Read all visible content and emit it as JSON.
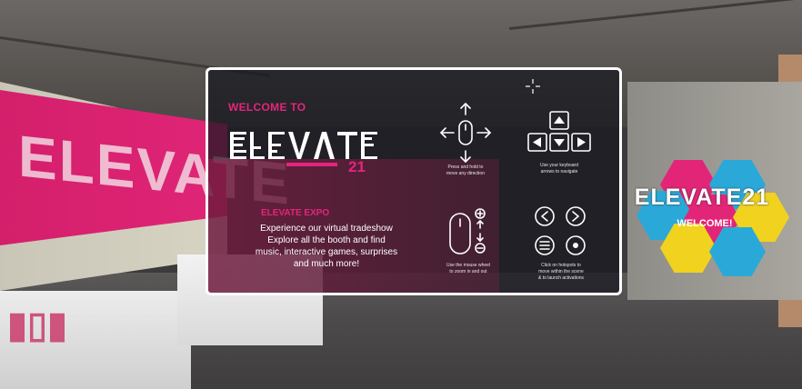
{
  "background": {
    "wall_sign_text": "ELEVATE",
    "standee_title": "ELEVATE21",
    "standee_subtitle": "WELCOME!"
  },
  "modal": {
    "welcome_heading": "WELCOME TO",
    "logo_text": "ELEVATE",
    "logo_number": "21",
    "expo_title": "ELEVATE EXPO",
    "description_lines": [
      "Experience our virtual tradeshow",
      "Explore all the booth and find",
      "music, interactive games, surprises",
      "and much more!"
    ],
    "controls": {
      "drag": {
        "icon": "mouse-drag-icon",
        "caption_lines": [
          "Press and hold to",
          "move any direction"
        ]
      },
      "keyboard": {
        "icon": "arrow-keys-icon",
        "caption_lines": [
          "Use your keyboard",
          "arrows to navigate"
        ]
      },
      "zoom": {
        "icon": "mouse-wheel-icon",
        "caption_lines": [
          "Use the mouse wheel",
          "to zoom in and out"
        ]
      },
      "hotspots": {
        "icon": "hotspot-icons",
        "caption_lines": [
          "Click on hotspots to",
          "move within the scene",
          "& to launch activations"
        ]
      }
    }
  },
  "colors": {
    "accent": "#e3257b",
    "modal_border": "#ffffff",
    "modal_bg": "#16161e"
  }
}
